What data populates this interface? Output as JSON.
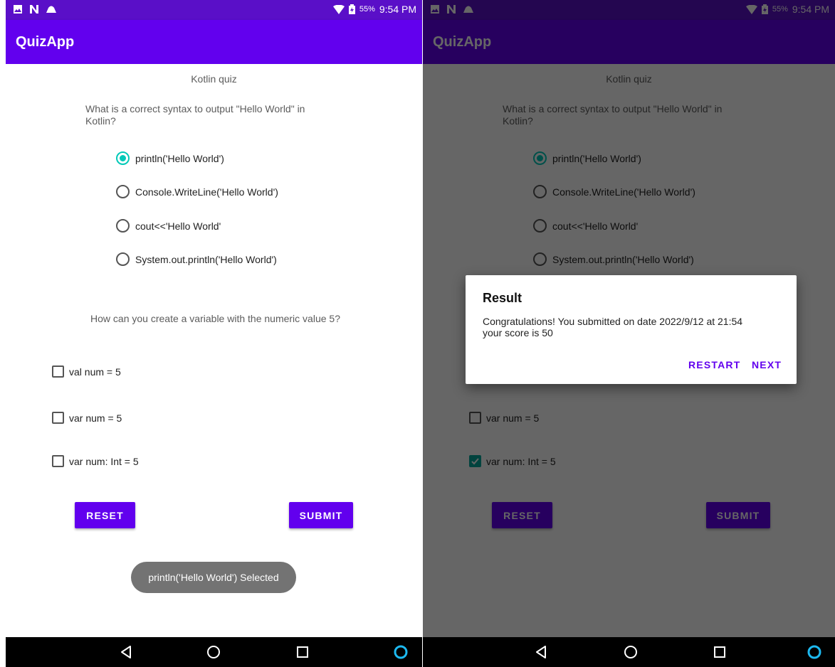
{
  "status_bar": {
    "battery_pct": "55%",
    "time": "9:54 PM"
  },
  "app_bar": {
    "title": "QuizApp"
  },
  "quiz": {
    "title": "Kotlin quiz",
    "question1": "What is a correct syntax to output \"Hello World\" in Kotlin?",
    "options1": [
      "println('Hello World')",
      "Console.WriteLine('Hello World')",
      "cout<<'Hello World'",
      "System.out.println('Hello World')"
    ],
    "question2": "How can you create a variable with the numeric value 5?",
    "options2": [
      "val num = 5",
      "var num = 5",
      "var num: Int = 5"
    ],
    "reset_label": "RESET",
    "submit_label": "SUBMIT"
  },
  "toast": {
    "text": "println('Hello World') Selected"
  },
  "dialog": {
    "title": "Result",
    "message": "Congratulations! You submitted on date 2022/9/12 at 21:54\n your score is 50",
    "restart_label": "RESTART",
    "next_label": "NEXT"
  },
  "colors": {
    "primary": "#6200ee",
    "primary_dark": "#5a0fc8",
    "accent": "#03c9b8"
  },
  "icons": [
    "image-icon",
    "n-icon",
    "cloud-icon",
    "wifi-icon",
    "battery-icon",
    "back-icon",
    "home-icon",
    "recents-icon",
    "assistant-icon"
  ]
}
